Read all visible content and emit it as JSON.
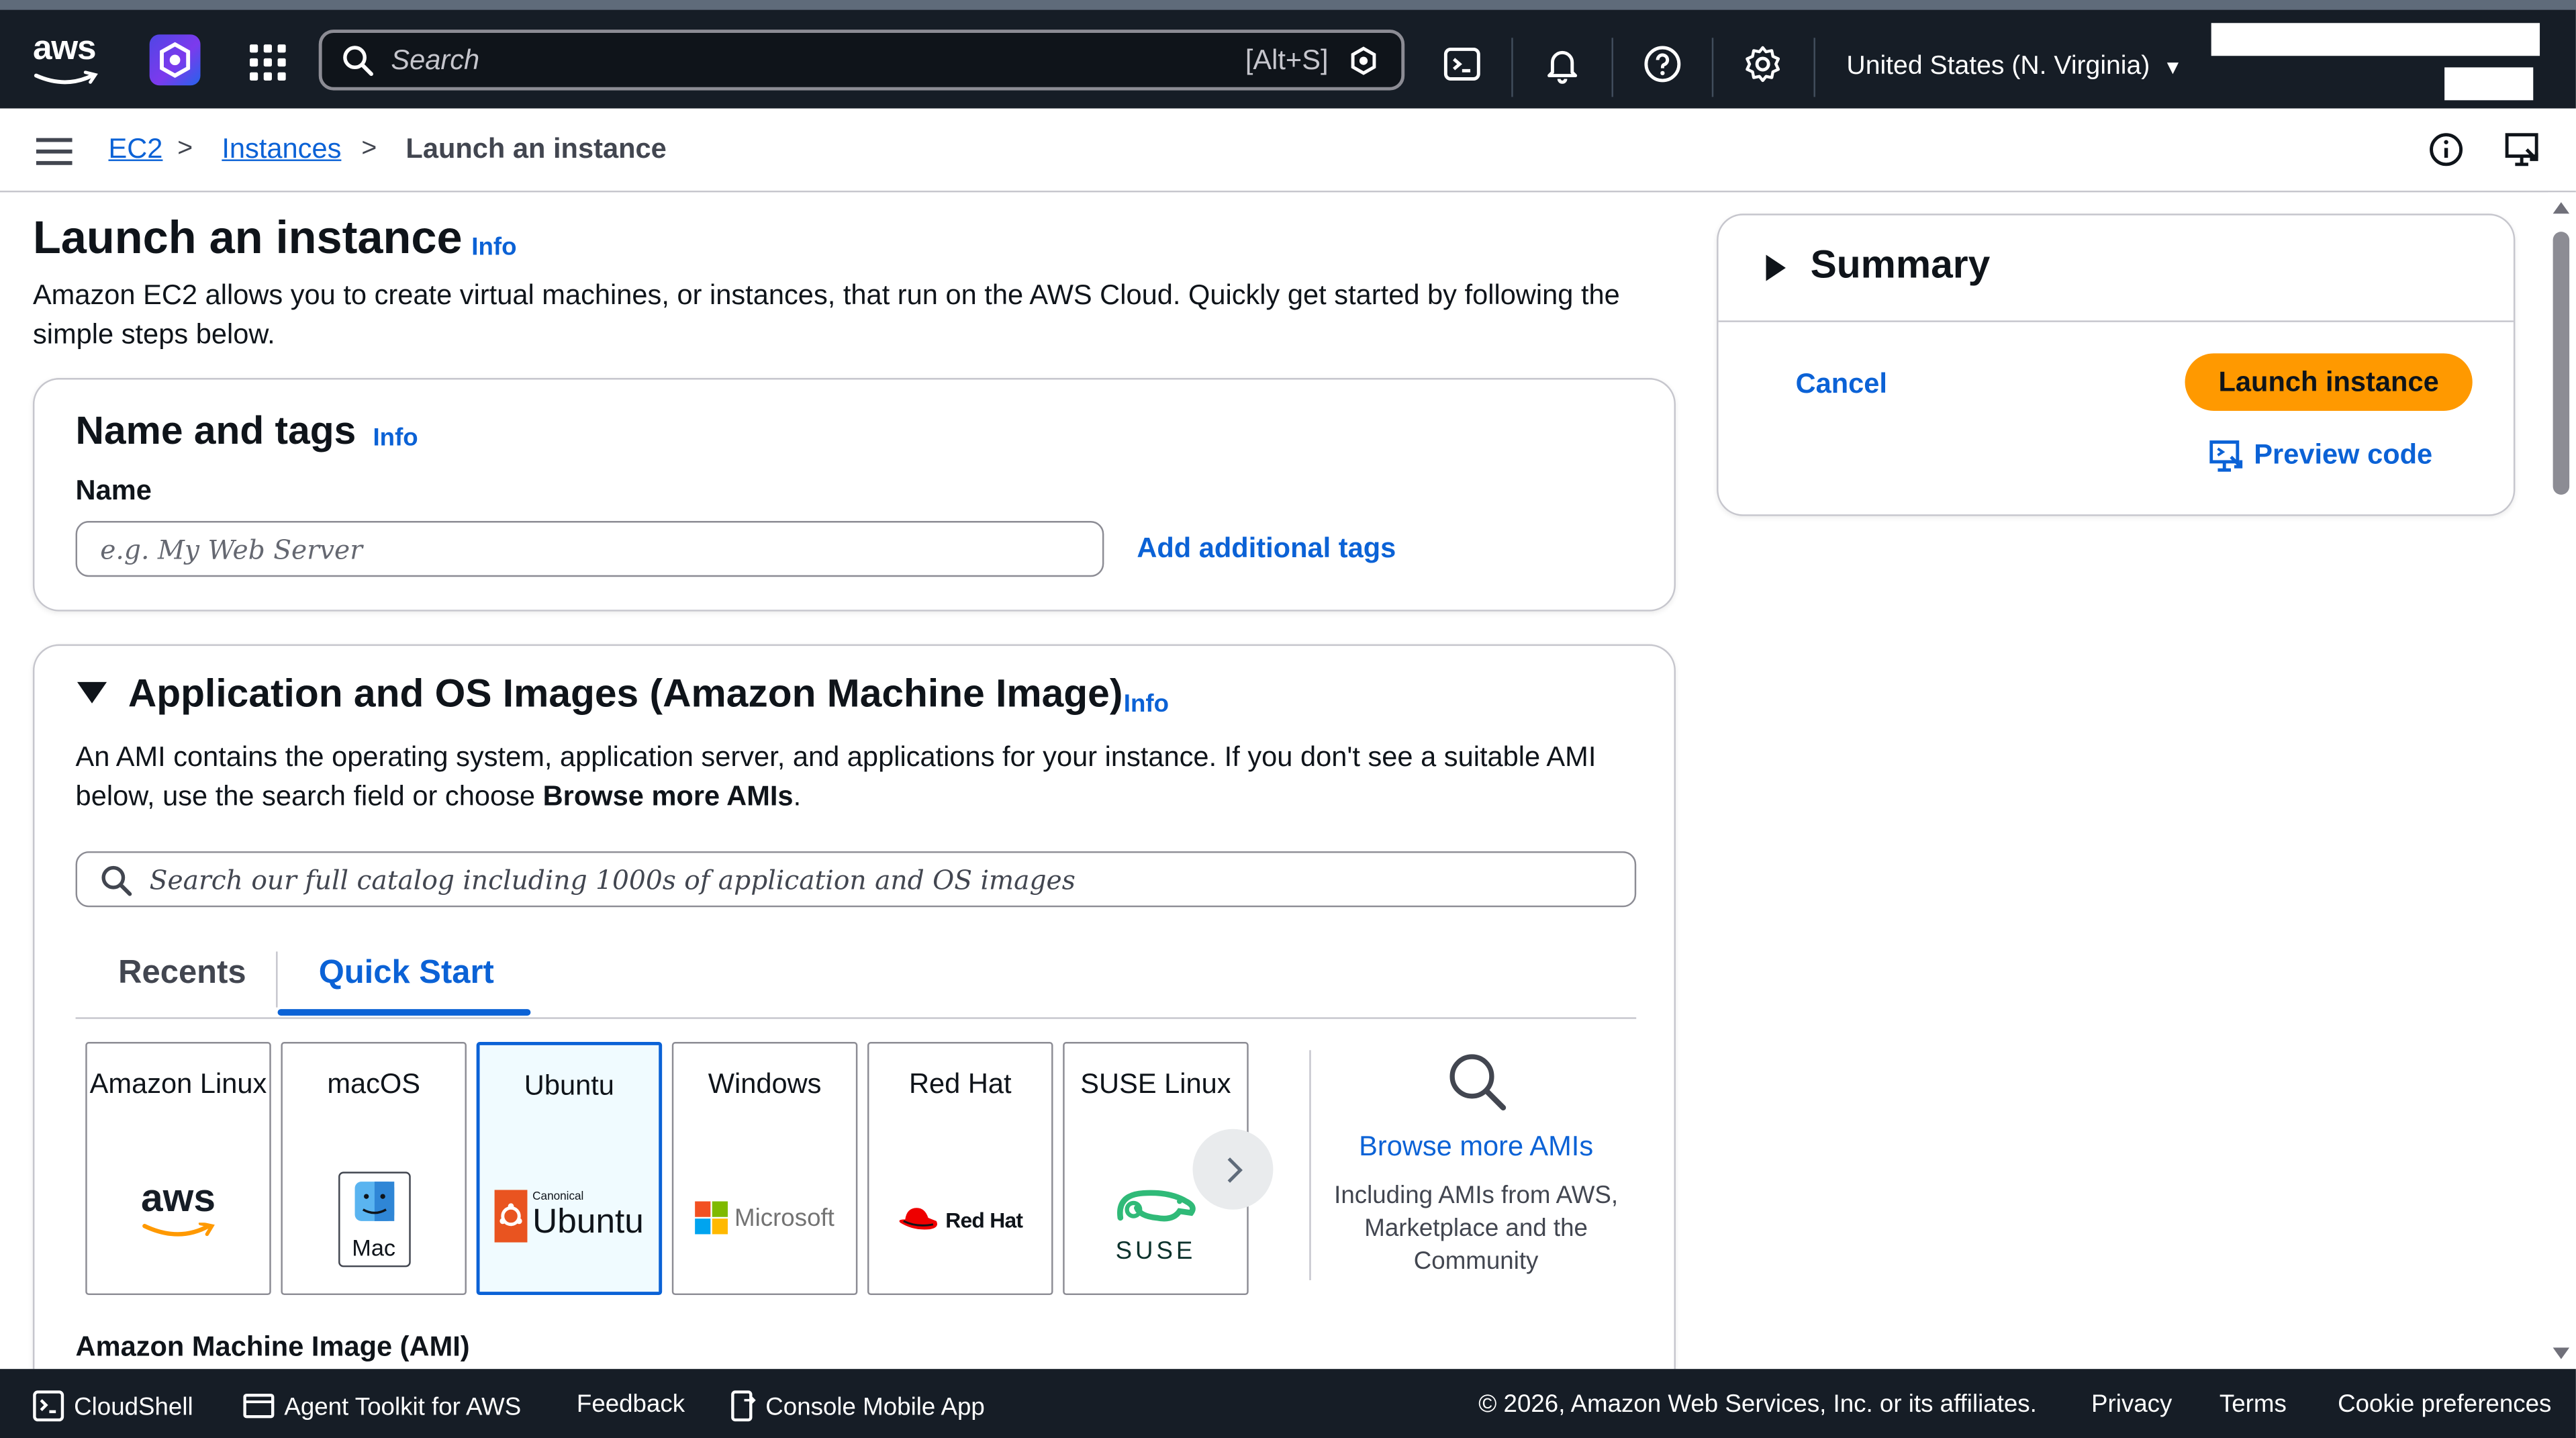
{
  "topnav": {
    "logo_text": "aws",
    "search": {
      "placeholder": "Search",
      "shortcut": "[Alt+S]"
    },
    "region": "United States (N. Virginia)"
  },
  "breadcrumb": {
    "items": [
      "EC2",
      "Instances"
    ],
    "current": "Launch an instance"
  },
  "page": {
    "title": "Launch an instance",
    "info": "Info",
    "description": "Amazon EC2 allows you to create virtual machines, or instances, that run on the AWS Cloud. Quickly get started by following the simple steps below."
  },
  "name_tags": {
    "title": "Name and tags",
    "info": "Info",
    "name_label": "Name",
    "name_placeholder": "e.g. My Web Server",
    "name_value": "",
    "add_tags": "Add additional tags"
  },
  "ami": {
    "title": "Application and OS Images (Amazon Machine Image)",
    "info": "Info",
    "description_prefix": "An AMI contains the operating system, application server, and applications for your instance. If you don't see a suitable AMI below, use the search field or choose ",
    "description_strong": "Browse more AMIs",
    "description_suffix": ".",
    "search_placeholder": "Search our full catalog including 1000s of application and OS images",
    "tabs": [
      "Recents",
      "Quick Start"
    ],
    "active_tab": "Quick Start",
    "os_tiles": [
      {
        "name": "Amazon Linux",
        "logo_text": "aws"
      },
      {
        "name": "macOS",
        "logo_text": "Mac"
      },
      {
        "name": "Ubuntu",
        "logo_text": "Ubuntu",
        "logo_small": "Canonical",
        "selected": true
      },
      {
        "name": "Windows",
        "logo_text": "Microsoft"
      },
      {
        "name": "Red Hat",
        "logo_text": "Red Hat"
      },
      {
        "name": "SUSE Linux",
        "logo_text": "SUSE"
      }
    ],
    "browse_more": "Browse more AMIs",
    "browse_sub": "Including AMIs from AWS, Marketplace and the Community",
    "section_label": "Amazon Machine Image (AMI)"
  },
  "summary": {
    "title": "Summary",
    "cancel": "Cancel",
    "launch": "Launch instance",
    "preview": "Preview code"
  },
  "footer": {
    "cloudshell": "CloudShell",
    "agent_toolkit": "Agent Toolkit for AWS",
    "feedback": "Feedback",
    "mobile_app": "Console Mobile App",
    "copyright": "© 2026, Amazon Web Services, Inc. or its affiliates.",
    "privacy": "Privacy",
    "terms": "Terms",
    "cookies": "Cookie preferences"
  },
  "colors": {
    "nav_bg": "#161d26",
    "link_blue": "#0b62d6",
    "launch_orange": "#ff9900",
    "selected_tile_bg": "#f0fbff"
  },
  "icons": [
    "aws-logo",
    "app-logo-icon",
    "grid-icon",
    "search-icon",
    "cloudshell-icon",
    "bell-icon",
    "help-icon",
    "gear-icon",
    "menu-icon",
    "info-icon",
    "present-icon",
    "chevron-right-icon",
    "magnifier-icon",
    "preview-code-icon"
  ]
}
